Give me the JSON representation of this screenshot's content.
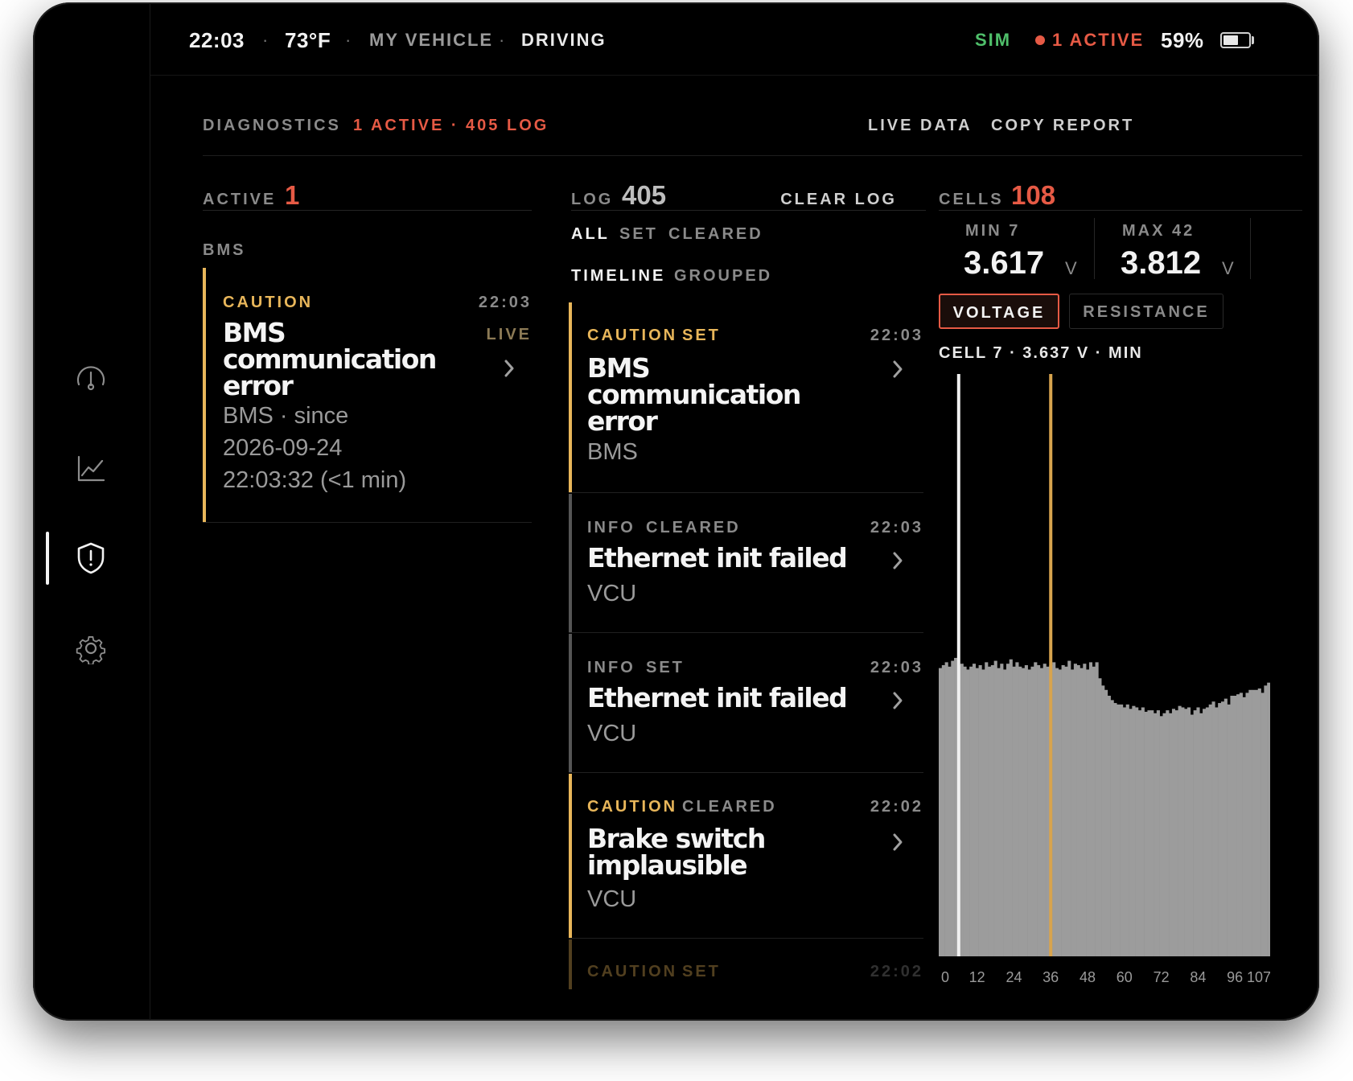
{
  "status": {
    "time": "22:03",
    "temp": "73°F",
    "vehicle": "MY VEHICLE",
    "mode": "DRIVING",
    "sim": "SIM",
    "active": "1 ACTIVE",
    "battery": "59%",
    "battery_level": 0.59
  },
  "nav": {
    "items": [
      "gauge",
      "chart",
      "diagnostics",
      "settings"
    ],
    "active": "diagnostics"
  },
  "header": {
    "title": "DIAGNOSTICS",
    "summary": "1 ACTIVE · 405 LOG",
    "live_data": "LIVE DATA",
    "copy_report": "COPY REPORT"
  },
  "active_panel": {
    "label": "ACTIVE",
    "count": "1",
    "group": "BMS",
    "card": {
      "severity": "CAUTION",
      "time": "22:03",
      "live": "LIVE",
      "title": "BMS communication error",
      "sub1": "BMS · since",
      "sub2": "2026-09-24",
      "sub3": "22:03:32 (<1 min)"
    }
  },
  "log_panel": {
    "label": "LOG",
    "count": "405",
    "clear": "CLEAR LOG",
    "filters": [
      "ALL",
      "SET",
      "CLEARED"
    ],
    "views": [
      "TIMELINE",
      "GROUPED"
    ],
    "entries": [
      {
        "severity": "CAUTION",
        "state": "SET",
        "time": "22:03",
        "title": "BMS communication error",
        "source": "BMS"
      },
      {
        "severity": "INFO",
        "state": "CLEARED",
        "time": "22:03",
        "title": "Ethernet init failed",
        "source": "VCU"
      },
      {
        "severity": "INFO",
        "state": "SET",
        "time": "22:03",
        "title": "Ethernet init failed",
        "source": "VCU"
      },
      {
        "severity": "CAUTION",
        "state": "CLEARED",
        "time": "22:02",
        "title": "Brake switch implausible",
        "source": "VCU"
      },
      {
        "severity": "CAUTION",
        "state": "SET",
        "time": "22:02",
        "title": "",
        "source": ""
      }
    ]
  },
  "cells_panel": {
    "label": "CELLS",
    "count": "108",
    "min_label": "MIN 7",
    "min_value": "3.617",
    "max_label": "MAX 42",
    "max_value": "3.812",
    "unit": "V",
    "tabs": [
      "VOLTAGE",
      "RESISTANCE"
    ],
    "selected_tab": "VOLTAGE",
    "selection": "CELL 7 · 3.637 V · MIN"
  },
  "colors": {
    "accent_red": "#e65a45",
    "caution": "#e8b65a",
    "sim": "#4fbf6a",
    "bar": "#9c9c9c",
    "marker_min": "#f0f0f0",
    "marker_max": "#d8a44e"
  },
  "chart_data": {
    "type": "bar",
    "x_ticks": [
      "0",
      "12",
      "24",
      "36",
      "48",
      "60",
      "72",
      "84",
      "96",
      "107"
    ],
    "highlight_min_cell": 6,
    "highlight_max_cell": 36,
    "ylim": [
      3.5,
      3.9
    ],
    "values": [
      3.698,
      3.7,
      3.702,
      3.699,
      3.703,
      3.705,
      3.7,
      3.701,
      3.699,
      3.697,
      3.699,
      3.701,
      3.698,
      3.7,
      3.697,
      3.702,
      3.699,
      3.7,
      3.703,
      3.698,
      3.701,
      3.697,
      3.701,
      3.704,
      3.699,
      3.702,
      3.699,
      3.698,
      3.7,
      3.697,
      3.699,
      3.702,
      3.7,
      3.698,
      3.701,
      3.699,
      3.7,
      3.702,
      3.698,
      3.697,
      3.7,
      3.699,
      3.703,
      3.697,
      3.701,
      3.7,
      3.698,
      3.701,
      3.697,
      3.702,
      3.699,
      3.702,
      3.691,
      3.686,
      3.683,
      3.679,
      3.676,
      3.674,
      3.673,
      3.673,
      3.671,
      3.673,
      3.67,
      3.672,
      3.671,
      3.669,
      3.671,
      3.668,
      3.669,
      3.669,
      3.667,
      3.669,
      3.665,
      3.667,
      3.669,
      3.667,
      3.67,
      3.669,
      3.672,
      3.671,
      3.67,
      3.671,
      3.666,
      3.669,
      3.671,
      3.667,
      3.67,
      3.671,
      3.673,
      3.675,
      3.671,
      3.674,
      3.675,
      3.677,
      3.673,
      3.679,
      3.679,
      3.68,
      3.681,
      3.678,
      3.681,
      3.683,
      3.683,
      3.683,
      3.684,
      3.681,
      3.686,
      3.688
    ]
  }
}
